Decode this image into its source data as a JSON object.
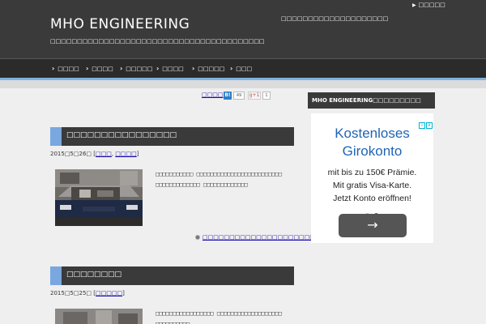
{
  "header": {
    "site_title": "MHO ENGINEERING",
    "site_description": "□□□□□□□□□□□□□□□□□□□□□□□□□□□□□□□□□□□□□□□□",
    "right_description": "□□□□□□□□□□□□□□□□□□□□",
    "top_link": "□□□□□"
  },
  "nav": {
    "items": [
      {
        "label": "□□□□"
      },
      {
        "label": "□□□□"
      },
      {
        "label": "□□□□□"
      },
      {
        "label": "□□□□"
      },
      {
        "label": "□□□□□"
      },
      {
        "label": "□□□"
      }
    ]
  },
  "social": {
    "share_label": "□□□□",
    "hatena_icon": "B!",
    "hatena_count": "49",
    "gplus_label": "g+1",
    "gplus_count": "1"
  },
  "posts": [
    {
      "title": "□□□□□□□□□□□□□□□□",
      "date": "2015□5□26□",
      "cat1": "□□□",
      "cat2": "□□□□",
      "excerpt": "□□□□□□□□□□□ □□□□□□□□□□□□□□□□□□□□□□□□□ □□□□□□□□□□□□□ □□□□□□□□□□□□□",
      "more": "□□□□□□□□□□□□□□□□□□□□□□□□□□□□□"
    },
    {
      "title": "□□□□□□□□",
      "date": "2015□5□25□",
      "cat1": "□□□□□",
      "excerpt": "□□□□□□□□□□□□□□□□□ □□□□□□□□□□□□□□□□□□□ □□□□□□□□□□"
    }
  ],
  "sidebar": {
    "widget_title": "MHO ENGINEERING□□□□□□□□□"
  },
  "ad": {
    "headline_1": "Kostenloses",
    "headline_2": "Girokonto",
    "line_1": "mit bis zu 150€ Prämie.",
    "line_2": "Mit gratis Visa-Karte.",
    "line_3": "Jetzt Konto eröffnen!",
    "arrow": "→",
    "info_icon": "i",
    "close_icon": "x"
  },
  "colors": {
    "header_bg": "#3a3a3a",
    "nav_stripe": "#7db3df",
    "title_accent": "#7aa7e0",
    "ad_headline": "#1f64b4"
  }
}
